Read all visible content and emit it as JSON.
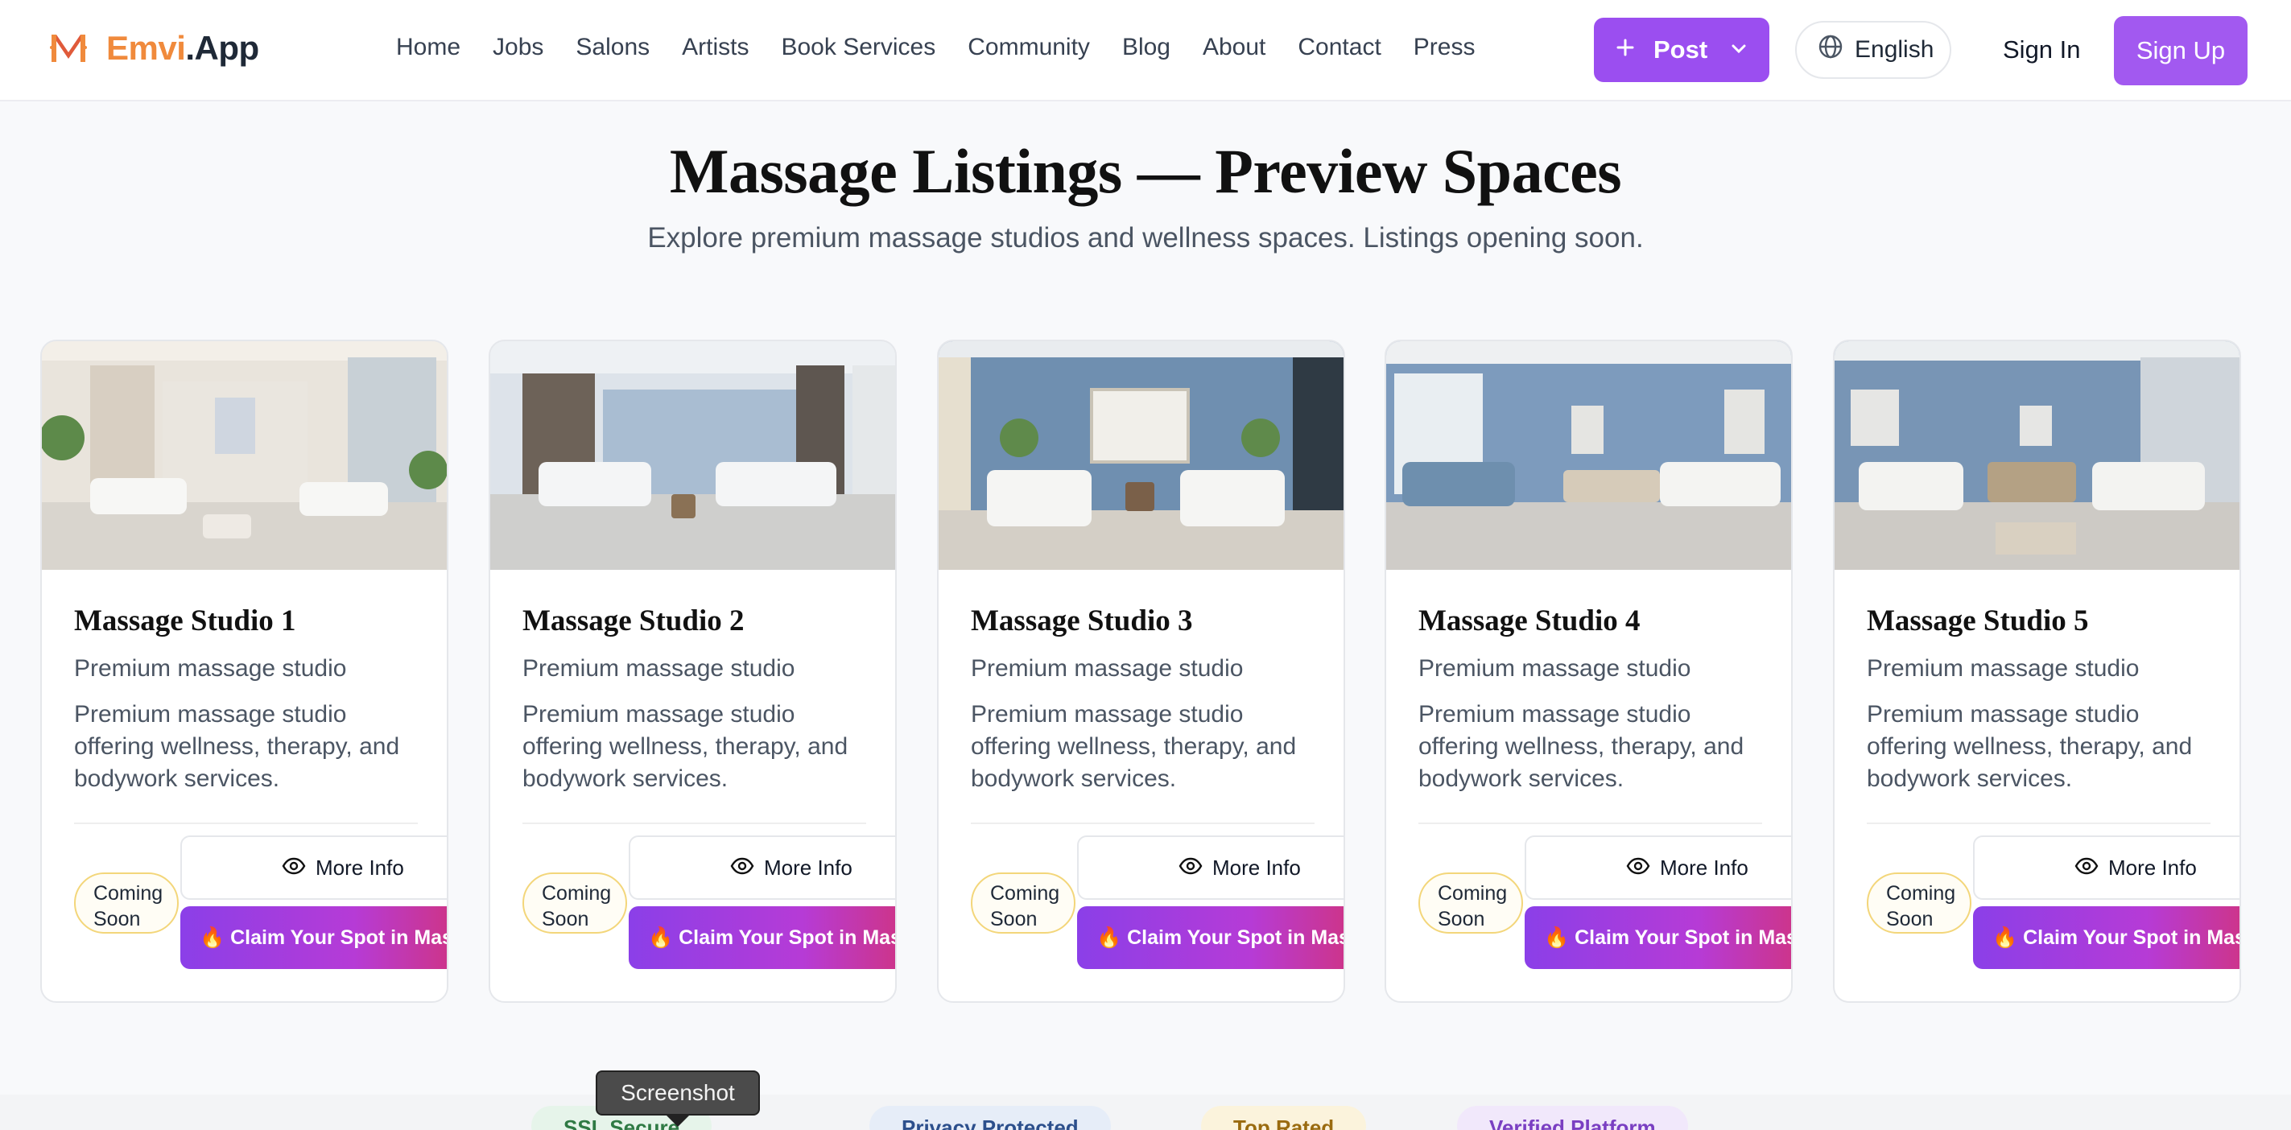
{
  "header": {
    "logo_letter": "M",
    "logo_name_part1": "Emvi",
    "logo_name_part2": ".App",
    "nav": [
      "Home",
      "Jobs",
      "Salons",
      "Artists",
      "Book Services",
      "Community",
      "Blog",
      "About",
      "Contact",
      "Press"
    ],
    "post_label": "Post",
    "language_label": "English",
    "sign_in_label": "Sign In",
    "sign_up_label": "Sign Up"
  },
  "hero": {
    "title": "Massage Listings — Preview Spaces",
    "subtitle": "Explore premium massage studios and wellness spaces. Listings opening soon."
  },
  "cards": [
    {
      "title": "Massage Studio 1",
      "subtitle": "Premium massage studio",
      "description": "Premium massage studio offering wellness, therapy, and bodywork services.",
      "badge": "Coming Soon",
      "more_info": "More Info",
      "claim": "🔥 Claim Your Spot in Massage"
    },
    {
      "title": "Massage Studio 2",
      "subtitle": "Premium massage studio",
      "description": "Premium massage studio offering wellness, therapy, and bodywork services.",
      "badge": "Coming Soon",
      "more_info": "More Info",
      "claim": "🔥 Claim Your Spot in Massage"
    },
    {
      "title": "Massage Studio 3",
      "subtitle": "Premium massage studio",
      "description": "Premium massage studio offering wellness, therapy, and bodywork services.",
      "badge": "Coming Soon",
      "more_info": "More Info",
      "claim": "🔥 Claim Your Spot in Massage"
    },
    {
      "title": "Massage Studio 4",
      "subtitle": "Premium massage studio",
      "description": "Premium massage studio offering wellness, therapy, and bodywork services.",
      "badge": "Coming Soon",
      "more_info": "More Info",
      "claim": "🔥 Claim Your Spot in Massage"
    },
    {
      "title": "Massage Studio 5",
      "subtitle": "Premium massage studio",
      "description": "Premium massage studio offering wellness, therapy, and bodywork services.",
      "badge": "Coming Soon",
      "more_info": "More Info",
      "claim": "🔥 Claim Your Spot in Massage"
    }
  ],
  "trust_badges": [
    "SSL Secure",
    "Privacy Protected",
    "Top Rated",
    "Verified Platform"
  ],
  "tooltip": "Screenshot",
  "colors": {
    "accent": "#9b4ef0",
    "logo_orange": "#f08a3c",
    "badge_border": "#f3d67a"
  }
}
